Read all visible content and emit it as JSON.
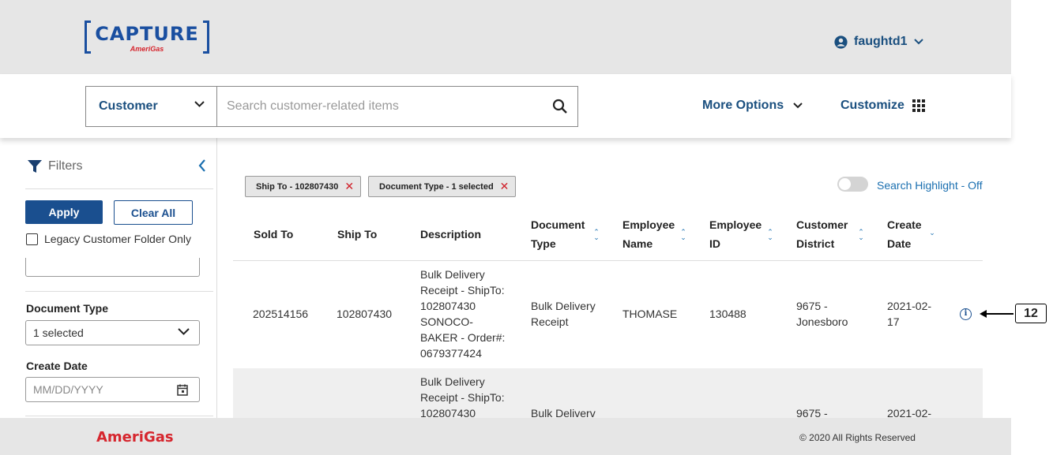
{
  "brand": {
    "app_name": "CAPTURE",
    "company": "AmeriGas",
    "primary_color": "#1a4f8f",
    "accent_red": "#d6262e"
  },
  "user": {
    "name": "faughtd1",
    "icon": "user-circle-icon"
  },
  "search": {
    "scope": "Customer",
    "placeholder": "Search customer-related items"
  },
  "nav": {
    "more_options": "More Options",
    "customize": "Customize"
  },
  "sidebar": {
    "title": "Filters",
    "apply": "Apply",
    "clear_all": "Clear All",
    "legacy_label": "Legacy Customer Folder Only",
    "legacy_checked": false,
    "document_type_label": "Document Type",
    "document_type_value": "1 selected",
    "create_date_label": "Create Date",
    "create_date_placeholder": "MM/DD/YYYY"
  },
  "chips": [
    {
      "label": "Ship To - 102807430"
    },
    {
      "label": "Document Type - 1 selected"
    }
  ],
  "highlight_toggle": {
    "label": "Search Highlight - Off",
    "on": false
  },
  "table": {
    "headers": {
      "sold_to": "Sold To",
      "ship_to": "Ship To",
      "description": "Description",
      "document_type_1": "Document",
      "document_type_2": "Type",
      "employee_name_1": "Employee",
      "employee_name_2": "Name",
      "employee_id_1": "Employee",
      "employee_id_2": "ID",
      "customer_district_1": "Customer",
      "customer_district_2": "District",
      "create_date_1": "Create",
      "create_date_2": "Date"
    },
    "rows": [
      {
        "sold_to": "202514156",
        "ship_to": "102807430",
        "description": [
          "Bulk Delivery",
          "Receipt - ShipTo:",
          "102807430",
          "SONOCO-",
          "BAKER - Order#:",
          "0679377424"
        ],
        "document_type": [
          "Bulk Delivery",
          "Receipt"
        ],
        "employee_name": "THOMASE",
        "employee_id": "130488",
        "customer_district": [
          "9675 -",
          "Jonesboro"
        ],
        "create_date": [
          "2021-02-",
          "17"
        ]
      },
      {
        "description": [
          "Bulk Delivery",
          "Receipt - ShipTo:",
          "102807430"
        ],
        "document_type": [
          "Bulk Deliverv"
        ],
        "customer_district": [
          "9675 -"
        ],
        "create_date": [
          "2021-02-"
        ]
      }
    ]
  },
  "callout": {
    "label": "12"
  },
  "footer": {
    "logo": "AmeriGas",
    "copyright": "© 2020 All Rights Reserved"
  }
}
